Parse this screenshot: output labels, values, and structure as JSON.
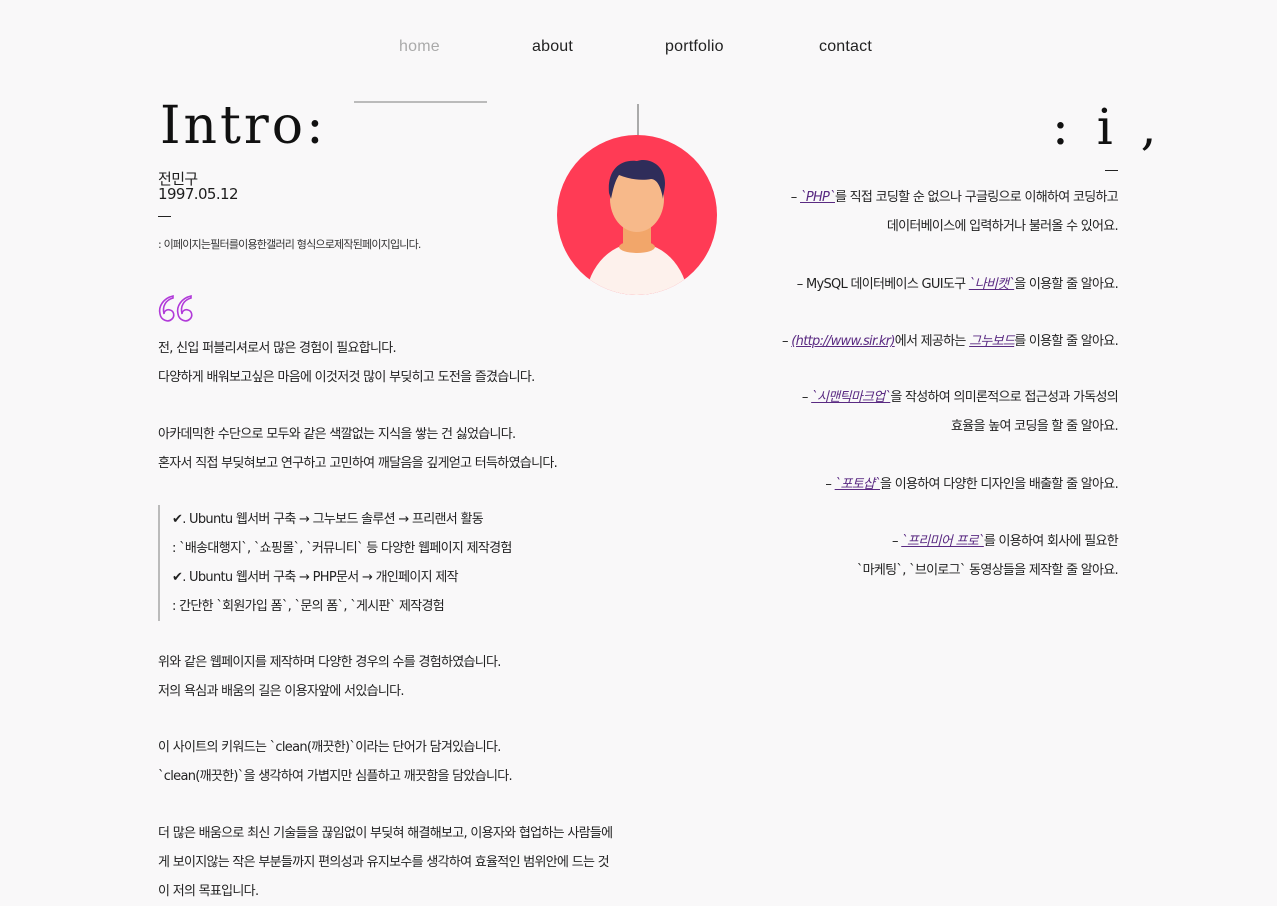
{
  "nav": {
    "items": [
      "home",
      "about",
      "portfolio",
      "contact"
    ],
    "active": "home"
  },
  "intro": {
    "title": "Intro:",
    "name": "전민구",
    "dob": "1997.05.12",
    "description": ": 이페이지는필터를이용한갤러리 형식으로제작된페이지입니다."
  },
  "right_title": ": i ,",
  "quote_icon": "quote-icon",
  "left_text": {
    "para1": [
      "전, 신입 퍼블리셔로서 많은 경험이 필요합니다.",
      "다양하게 배워보고싶은 마음에 이것저것 많이 부딪히고 도전을 즐겼습니다."
    ],
    "para2": [
      "아카데믹한 수단으로 모두와 같은 색깔없는 지식을 쌓는 건 싫었습니다.",
      "혼자서 직접 부딪혀보고 연구하고 고민하여 깨달음을 깊게얻고 터득하였습니다."
    ],
    "list": [
      "✔. Ubuntu 웹서버 구축 → 그누보드 솔루션 → 프리랜서 활동",
      ": `배송대행지`, `쇼핑몰`, `커뮤니티` 등 다양한 웹페이지 제작경험",
      "✔. Ubuntu 웹서버 구축 → PHP문서 → 개인페이지 제작",
      ": 간단한 `회원가입 폼`, `문의 폼`, `게시판` 제작경험"
    ],
    "para3": [
      "위와 같은 웹페이지를 제작하며 다양한 경우의 수를 경험하였습니다.",
      "저의 욕심과 배움의 길은 이용자앞에 서있습니다."
    ],
    "para4": [
      "이 사이트의 키워드는 `clean(깨끗한)`이라는 단어가 담겨있습니다.",
      "`clean(깨끗한)`을 생각하여 가볍지만 심플하고 깨끗함을 담았습니다."
    ],
    "para5": [
      "더 많은 배움으로 최신 기술들을 끊임없이 부딪혀 해결해보고, 이용자와 협업하는 사람들에",
      "게 보이지않는 작은 부분들까지 편의성과 유지보수를 생각하여 효율적인 범위안에 드는 것",
      "이 저의 목표입니다."
    ]
  },
  "right_text": {
    "r1_prefix": "– ",
    "r1_hl": "`PHP`",
    "r1_rest": "를 직접 코딩할 순 없으나 구글링으로 이해하여 코딩하고",
    "r1_line2": "데이터베이스에 입력하거나 불러올 수 있어요.",
    "r2_prefix": "– MySQL 데이터베이스 GUI도구 ",
    "r2_hl": "`나비캣`",
    "r2_rest": "을 이용할 줄 알아요.",
    "r3_prefix": "– ",
    "r3_hl": "(http://www.sir.kr)",
    "r3_mid": "에서 제공하는 ",
    "r3_hl2": "그누보드",
    "r3_rest": "를 이용할 줄 알아요.",
    "r4_prefix": "– ",
    "r4_hl": "`시맨틱마크업`",
    "r4_rest": "을 작성하여 의미론적으로 접근성과 가독성의",
    "r4_line2": "효율을 높여 코딩을 할 줄 알아요.",
    "r5_prefix": "– ",
    "r5_hl": "`포토샵`",
    "r5_rest": "을 이용하여 다양한 디자인을 배출할 줄 알아요.",
    "r6_prefix": "– ",
    "r6_hl": "`프리미어 프로`",
    "r6_rest": "를 이용하여 회사에 필요한",
    "r6_line2": "`마케팅`, `브이로그` 동영상들을 제작할 줄 알아요."
  },
  "colors": {
    "avatar_bg": "#ff3b55",
    "accent": "#5a2a82",
    "quote": "#b13ad9"
  }
}
